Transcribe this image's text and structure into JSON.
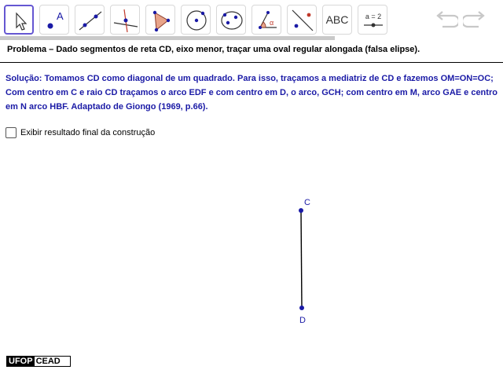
{
  "toolbar": {
    "tools": [
      {
        "name": "move-tool",
        "selected": true
      },
      {
        "name": "point-tool",
        "label": "A"
      },
      {
        "name": "line-tool"
      },
      {
        "name": "perpendicular-line-tool"
      },
      {
        "name": "polygon-tool"
      },
      {
        "name": "circle-center-point-tool"
      },
      {
        "name": "conic-tool"
      },
      {
        "name": "angle-tool",
        "label": "α"
      },
      {
        "name": "reflect-tool"
      },
      {
        "name": "text-tool",
        "label": "ABC"
      },
      {
        "name": "slider-tool",
        "label": "a = 2"
      }
    ]
  },
  "problem": "Problema – Dado segmentos de reta CD, eixo menor, traçar uma oval regular alongada (falsa elipse).",
  "solution": "Solução: Tomamos CD como diagonal de um quadrado. Para isso, traçamos a mediatriz de CD e fazemos OM=ON=OC; Com centro em C e raio CD traçamos o arco EDF e com centro em D, o arco, GCH; com centro em M, arco GAE e centro em N arco HBF.  Adaptado de Giongo (1969, p.66).",
  "checkbox": {
    "label": "Exibir resultado final da construção",
    "checked": false
  },
  "points": {
    "c": "C",
    "d": "D"
  },
  "logo": {
    "part1": "UFOP",
    "part2": "CEAD"
  },
  "colors": {
    "point": "#1a1aa6",
    "text_blue": "#1a1aa6",
    "selected_border": "#6557d2"
  }
}
